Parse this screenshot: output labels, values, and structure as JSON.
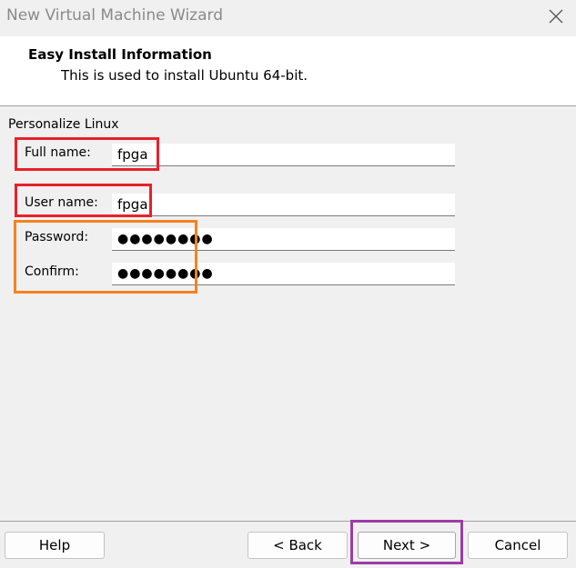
{
  "window": {
    "title": "New Virtual Machine Wizard",
    "close_icon": "close-icon"
  },
  "header": {
    "title": "Easy Install Information",
    "subtitle": "This is used to install Ubuntu 64-bit."
  },
  "form": {
    "section_label": "Personalize Linux",
    "full_name": {
      "label": "Full name:",
      "value": "fpga"
    },
    "user_name": {
      "label": "User name:",
      "value": "fpga"
    },
    "password": {
      "label": "Password:",
      "value": "●●●●●●●●"
    },
    "confirm": {
      "label": "Confirm:",
      "value": "●●●●●●●●"
    }
  },
  "buttons": {
    "help": "Help",
    "back": "< Back",
    "next": "Next >",
    "cancel": "Cancel"
  },
  "colors": {
    "highlight_red": "#e8202a",
    "highlight_orange": "#f58220",
    "highlight_purple": "#9b3ea5"
  }
}
